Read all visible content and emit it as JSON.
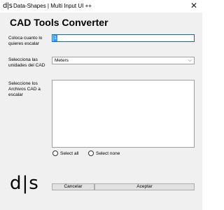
{
  "window": {
    "icon_text": "d|s",
    "title": "Data-Shapes | Multi Input UI ++",
    "close_glyph": "✕"
  },
  "app": {
    "title": "CAD Tools Converter"
  },
  "fields": {
    "scale": {
      "label": "Coloca cuanto lo quieres escalar",
      "value": "1"
    },
    "units": {
      "label": "Selecciona las unidades del CAD",
      "selected": "Meters",
      "chevron": "⌵"
    },
    "files": {
      "label": "Seleccione los Archivos CAD a escalar"
    }
  },
  "selection": {
    "select_all": "Select all",
    "select_none": "Select none"
  },
  "logo": {
    "text": "d|s"
  },
  "buttons": {
    "cancel": "Cancelar",
    "accept": "Aceptar"
  }
}
